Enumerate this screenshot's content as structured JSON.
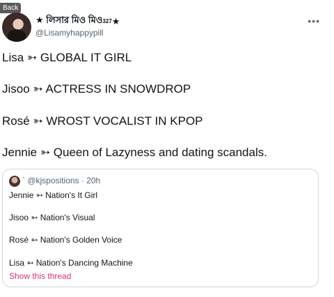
{
  "back_label": "Back",
  "author": {
    "display_name": "★ লিসার মিও মিও",
    "display_sup": "327",
    "display_suffix": "★",
    "handle": "@Lisamyhappypill"
  },
  "more_icon": "more-icon",
  "tweet_lines": [
    "Lisa ➳ GLOBAL IT GIRL",
    "Jisoo ➳ ACTRESS IN SNOWDROP",
    "Rosé ➳ WROST VOCALIST IN KPOP",
    "Jennie ➳  Queen of Lazyness and dating scandals."
  ],
  "quote": {
    "meta": "` @kjspositions · 20h",
    "lines": [
      "Jennie ➳ Nation's It Girl",
      "Jisoo ➳ Nation's Visual",
      "Rosé ➳ Nation's Golden Voice",
      "Lisa ➳ Nation's Dancing Machine"
    ],
    "show_thread": "Show this thread"
  },
  "colors": {
    "link": "#d6336c",
    "secondary": "#536471",
    "border": "#cfd9de"
  }
}
